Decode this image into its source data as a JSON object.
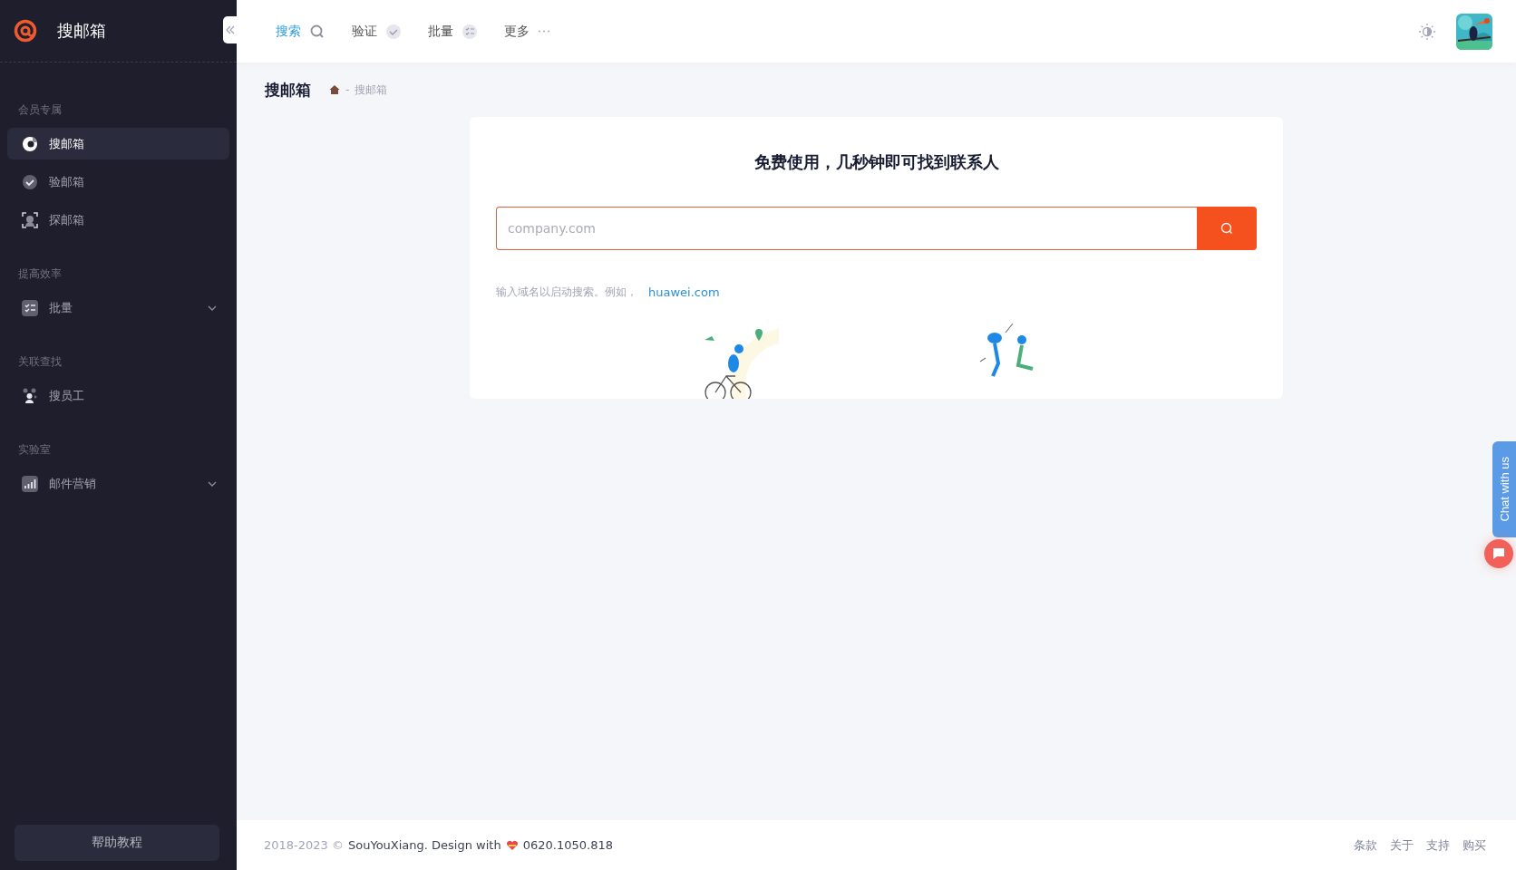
{
  "sidebar": {
    "brand": "搜邮箱",
    "sections": [
      {
        "title": "会员专属",
        "items": [
          {
            "label": "搜邮箱",
            "kind": "link",
            "selected": true
          },
          {
            "label": "验邮箱",
            "kind": "link",
            "selected": false
          },
          {
            "label": "探邮箱",
            "kind": "link",
            "selected": false
          }
        ]
      },
      {
        "title": "提高效率",
        "items": [
          {
            "label": "批量",
            "kind": "group",
            "selected": false
          }
        ]
      },
      {
        "title": "关联查找",
        "items": [
          {
            "label": "搜员工",
            "kind": "link",
            "selected": false
          }
        ]
      },
      {
        "title": "实验室",
        "items": [
          {
            "label": "邮件营销",
            "kind": "group",
            "selected": false
          }
        ]
      }
    ],
    "help_button": "帮助教程"
  },
  "tabs": [
    {
      "label": "搜索",
      "selected": true
    },
    {
      "label": "验证",
      "selected": false
    },
    {
      "label": "批量",
      "selected": false
    },
    {
      "label": "更多",
      "selected": false
    }
  ],
  "page": {
    "title": "搜邮箱",
    "breadcrumb": [
      "-",
      "搜邮箱"
    ]
  },
  "card": {
    "headline": "免费使用，几秒钟即可找到联系人",
    "search": {
      "placeholder": "company.com"
    },
    "hint": "输入域名以启动搜索。例如，",
    "hint_link": "huawei.com"
  },
  "footer": {
    "years": "2018-2023 ©",
    "credit": "SouYouXiang. Design with",
    "version": "0620.1050.818",
    "links": [
      "条款",
      "关于",
      "支持",
      "购买"
    ]
  },
  "chat": {
    "label": "Chat with us"
  }
}
